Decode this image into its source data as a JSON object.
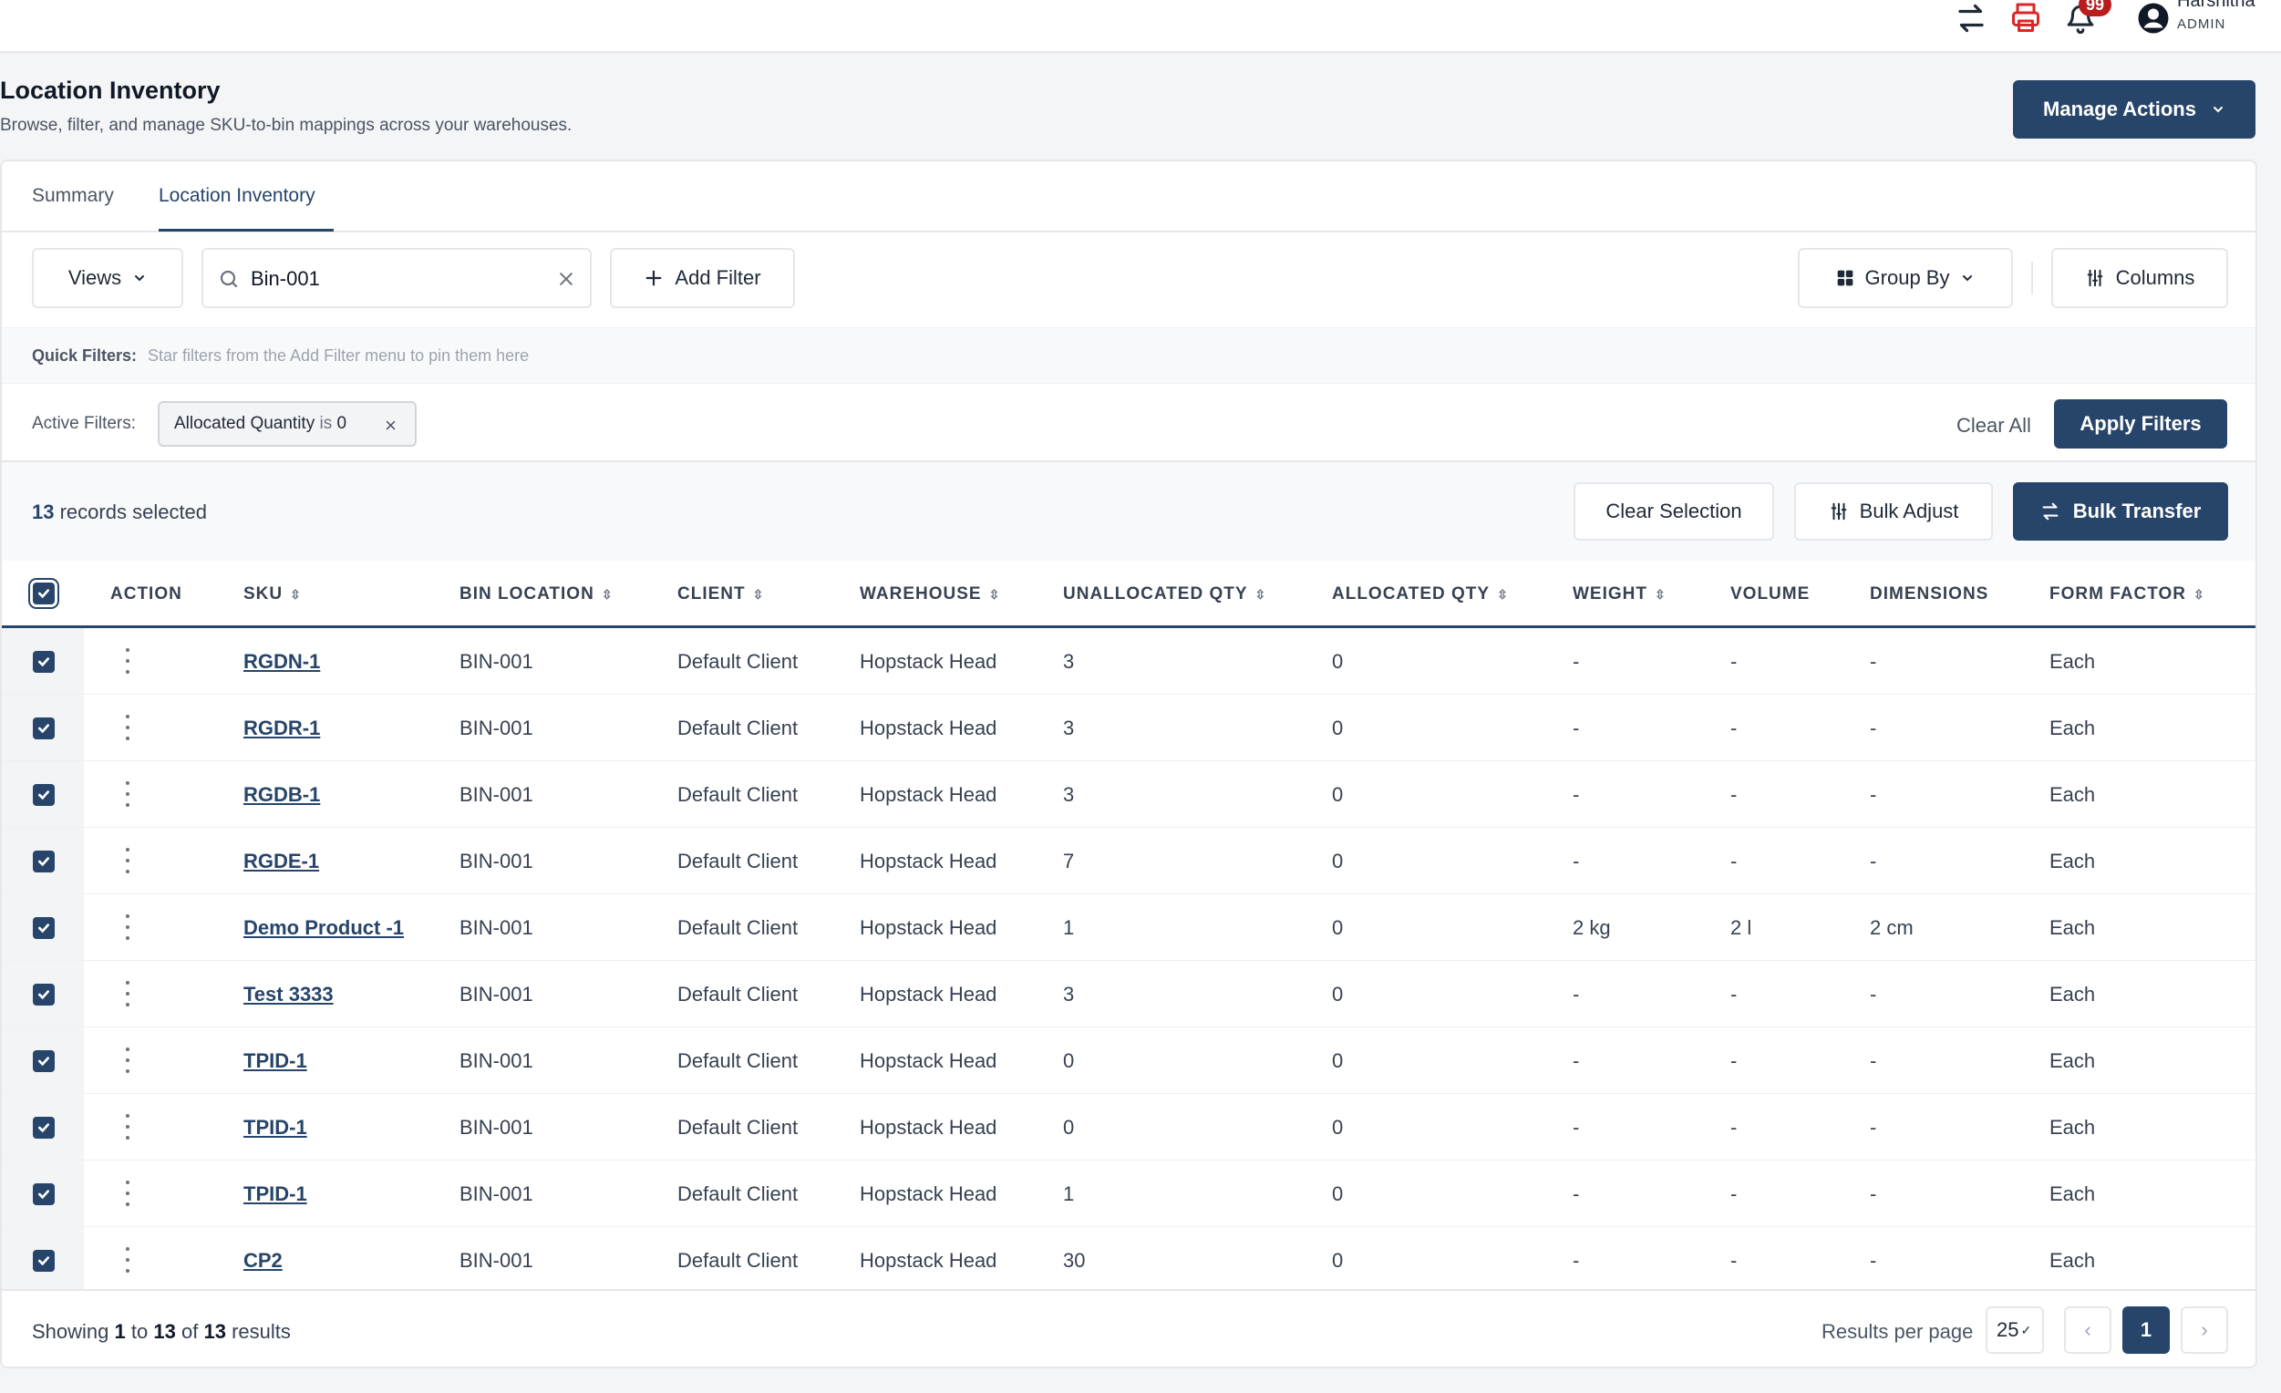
{
  "topbar": {
    "icons": [
      "transfer-icon",
      "printer-icon",
      "bell-icon",
      "user-icon"
    ],
    "notification_count": "99",
    "user_name": "Harshitha",
    "user_role": "ADMIN"
  },
  "header": {
    "title": "Location Inventory",
    "subtitle": "Browse, filter, and manage SKU-to-bin mappings across your warehouses.",
    "manage_actions": "Manage Actions"
  },
  "tabs": [
    {
      "label": "Summary",
      "active": false
    },
    {
      "label": "Location Inventory",
      "active": true
    }
  ],
  "toolbar": {
    "views": "Views",
    "search_value": "Bin-001",
    "add_filter": "Add Filter",
    "group_by": "Group By",
    "columns": "Columns"
  },
  "quick_filters": {
    "label": "Quick Filters:",
    "hint": "Star filters from the Add Filter menu to pin them here"
  },
  "active_filters": {
    "label": "Active Filters:",
    "chip_field": "Allocated Quantity",
    "chip_op": "is",
    "chip_value": "0",
    "clear_all": "Clear All",
    "apply": "Apply Filters"
  },
  "selection": {
    "count": "13",
    "text": "records selected",
    "clear_selection": "Clear Selection",
    "bulk_adjust": "Bulk Adjust",
    "bulk_transfer": "Bulk Transfer"
  },
  "table": {
    "headers": [
      "ACTION",
      "SKU",
      "BIN LOCATION",
      "CLIENT",
      "WAREHOUSE",
      "UNALLOCATED QTY",
      "ALLOCATED QTY",
      "WEIGHT",
      "VOLUME",
      "DIMENSIONS",
      "FORM FACTOR"
    ],
    "rows": [
      {
        "sku": "RGDN-1",
        "bin": "BIN-001",
        "client": "Default Client",
        "warehouse": "Hopstack Head",
        "unalloc": "3",
        "alloc": "0",
        "weight": "-",
        "volume": "-",
        "dims": "-",
        "form": "Each"
      },
      {
        "sku": "RGDR-1",
        "bin": "BIN-001",
        "client": "Default Client",
        "warehouse": "Hopstack Head",
        "unalloc": "3",
        "alloc": "0",
        "weight": "-",
        "volume": "-",
        "dims": "-",
        "form": "Each"
      },
      {
        "sku": "RGDB-1",
        "bin": "BIN-001",
        "client": "Default Client",
        "warehouse": "Hopstack Head",
        "unalloc": "3",
        "alloc": "0",
        "weight": "-",
        "volume": "-",
        "dims": "-",
        "form": "Each"
      },
      {
        "sku": "RGDE-1",
        "bin": "BIN-001",
        "client": "Default Client",
        "warehouse": "Hopstack Head",
        "unalloc": "7",
        "alloc": "0",
        "weight": "-",
        "volume": "-",
        "dims": "-",
        "form": "Each"
      },
      {
        "sku": "Demo Product -1",
        "bin": "BIN-001",
        "client": "Default Client",
        "warehouse": "Hopstack Head",
        "unalloc": "1",
        "alloc": "0",
        "weight": "2 kg",
        "volume": "2 l",
        "dims": "2 cm",
        "form": "Each"
      },
      {
        "sku": "Test 3333",
        "bin": "BIN-001",
        "client": "Default Client",
        "warehouse": "Hopstack Head",
        "unalloc": "3",
        "alloc": "0",
        "weight": "-",
        "volume": "-",
        "dims": "-",
        "form": "Each"
      },
      {
        "sku": "TPID-1",
        "bin": "BIN-001",
        "client": "Default Client",
        "warehouse": "Hopstack Head",
        "unalloc": "0",
        "alloc": "0",
        "weight": "-",
        "volume": "-",
        "dims": "-",
        "form": "Each"
      },
      {
        "sku": "TPID-1",
        "bin": "BIN-001",
        "client": "Default Client",
        "warehouse": "Hopstack Head",
        "unalloc": "0",
        "alloc": "0",
        "weight": "-",
        "volume": "-",
        "dims": "-",
        "form": "Each"
      },
      {
        "sku": "TPID-1",
        "bin": "BIN-001",
        "client": "Default Client",
        "warehouse": "Hopstack Head",
        "unalloc": "1",
        "alloc": "0",
        "weight": "-",
        "volume": "-",
        "dims": "-",
        "form": "Each"
      },
      {
        "sku": "CP2",
        "bin": "BIN-001",
        "client": "Default Client",
        "warehouse": "Hopstack Head",
        "unalloc": "30",
        "alloc": "0",
        "weight": "-",
        "volume": "-",
        "dims": "-",
        "form": "Each"
      }
    ]
  },
  "footer": {
    "showing": "Showing",
    "from": "1",
    "to_word": "to",
    "to": "13",
    "of_word": "of",
    "total": "13",
    "results_word": "results",
    "rpp_label": "Results per page",
    "rpp_value": "25",
    "current_page": "1"
  },
  "colors": {
    "accent": "#27456a",
    "badge": "#b91c1c"
  }
}
